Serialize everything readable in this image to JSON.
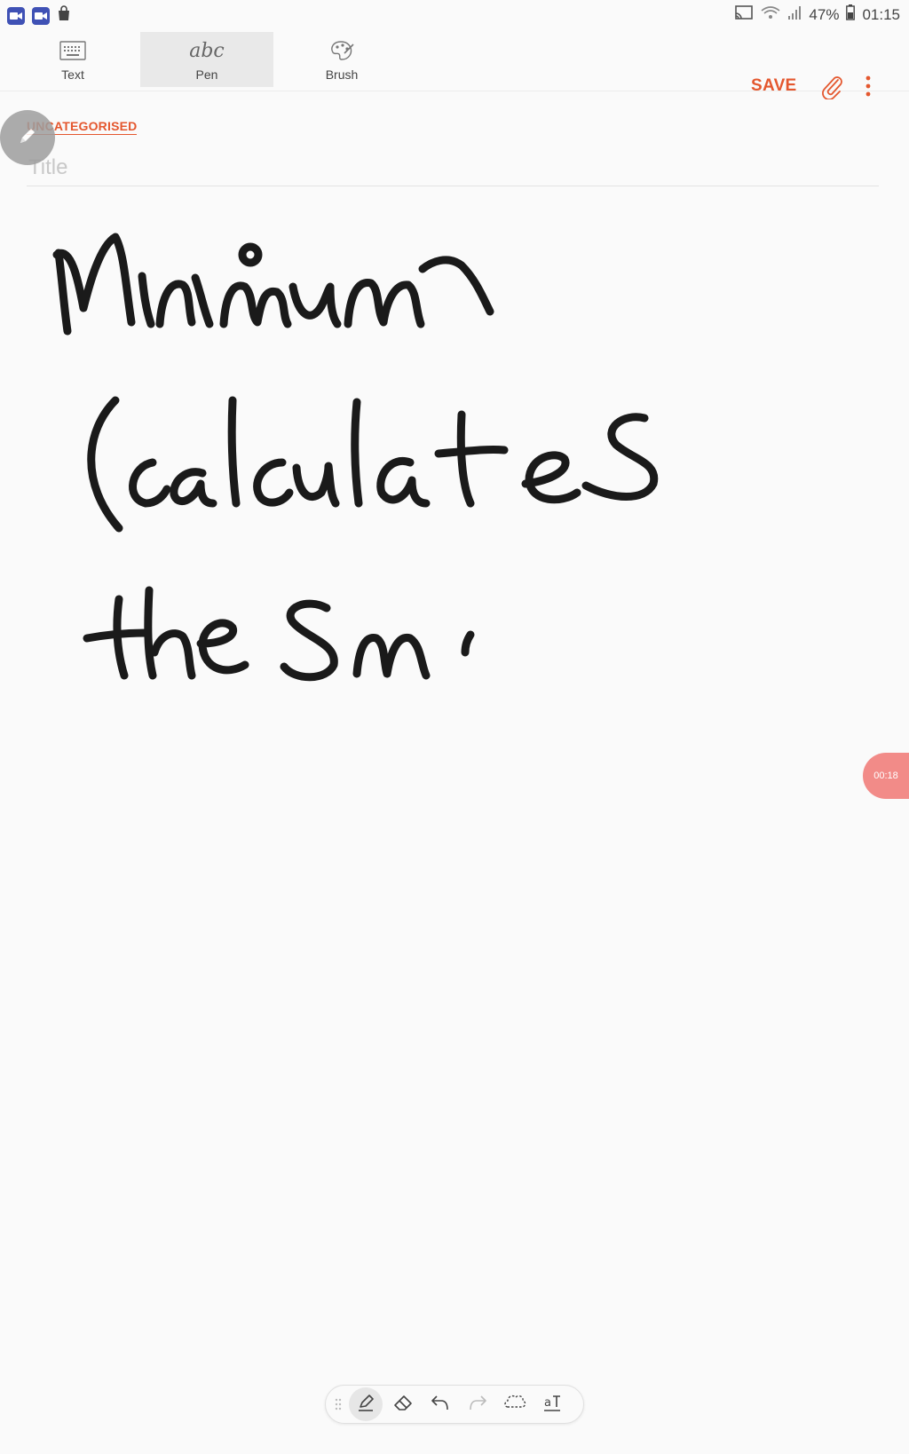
{
  "status_bar": {
    "battery": "47%",
    "time": "01:15"
  },
  "toolbar": {
    "modes": [
      {
        "label": "Text",
        "icon": "keyboard-icon",
        "active": false
      },
      {
        "label": "Pen",
        "icon": "abc-handwriting-icon",
        "glyph": "abc",
        "active": true
      },
      {
        "label": "Brush",
        "icon": "palette-icon",
        "active": false
      }
    ],
    "save_label": "SAVE",
    "attach_icon": "paperclip-icon",
    "more_icon": "more-vertical-icon"
  },
  "note": {
    "category": "UNCATEGORISED",
    "title_value": "",
    "title_placeholder": "Title",
    "handwriting": [
      "Minimum",
      "(calculates",
      "the sm"
    ]
  },
  "recording_badge": "00:18",
  "bottom_tools": [
    "pen-icon",
    "eraser-icon",
    "undo-icon",
    "redo-icon",
    "lasso-icon",
    "text-convert-icon"
  ],
  "colors": {
    "accent": "#e4572e",
    "ink": "#1a1a1a",
    "recording": "#f28b88"
  }
}
